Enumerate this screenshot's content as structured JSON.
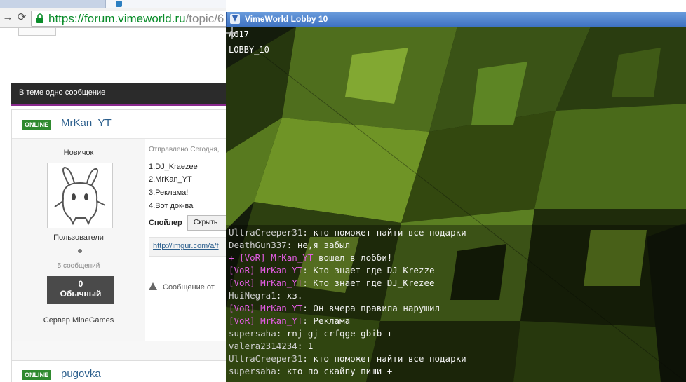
{
  "browser": {
    "url_host": "https://forum.vimeworld.ru",
    "url_path": "/topic/6",
    "topic_bar": "В теме одно сообщение",
    "post1": {
      "status": "ONLINE",
      "username": "MrKan_YT",
      "rank": "Новичок",
      "group": "Пользователи",
      "post_count": "5 сообщений",
      "rep_value": "0",
      "rep_label": "Обычный",
      "server_label": "Сервер",
      "server_name": "MineGames",
      "posted": "Отправлено Сегодня,",
      "lines": [
        "1.DJ_Kraezee",
        "2.MrKan_YT",
        "3.Реклама!",
        "4.Вот док-ва"
      ],
      "spoiler_label": "Спойлер",
      "spoiler_button": "Скрыть",
      "link": "http://imgur.com/a/f",
      "warning": "Сообщение от"
    },
    "post2": {
      "status": "ONLINE",
      "username": "pugovka"
    }
  },
  "game": {
    "window_title": "VimeWorld Lobby 10",
    "hud": [
      "AG17",
      "LOBBY_10"
    ],
    "chat": [
      {
        "prefix": "",
        "name": "UltraCreeper31",
        "text": ": кто поможет найти все подарки"
      },
      {
        "prefix": "",
        "name": "DeathGun337",
        "text": ": не,я забыл"
      },
      {
        "prefix": "+ [VoR] MrKan_YT",
        "name": "",
        "text": " вошел в лобби!"
      },
      {
        "prefix": "[VoR] MrKan_YT",
        "name": "",
        "text": ": Кто знает где DJ_Krezze"
      },
      {
        "prefix": "[VoR] MrKan_YT",
        "name": "",
        "text": ": Кто знает где DJ_Krezee"
      },
      {
        "prefix": "",
        "name": "HuiNegra1",
        "text": ": хз."
      },
      {
        "prefix": "[VoR] MrKan_YT",
        "name": "",
        "text": ": Он вчера правила нарушил"
      },
      {
        "prefix": "[VoR] MrKan_YT",
        "name": "",
        "text": ": Реклама"
      },
      {
        "prefix": "",
        "name": "supersaha",
        "text": ": rnj gj crfqge gbib +"
      },
      {
        "prefix": "",
        "name": "valera2314234",
        "text": ": 1"
      },
      {
        "prefix": "",
        "name": "UltraCreeper31",
        "text": ": кто поможет найти все подарки"
      },
      {
        "prefix": "",
        "name": "supersaha",
        "text": ": кто по скайпу пиши +"
      }
    ]
  },
  "colors": {
    "online_badge": "#2f8a2f",
    "username_link": "#2c5f8d",
    "url_green": "#0a8c2a",
    "topic_accent": "#8a2a8e",
    "chat_prefix": "#e25ce2",
    "titlebar": "#4a7fcc"
  }
}
